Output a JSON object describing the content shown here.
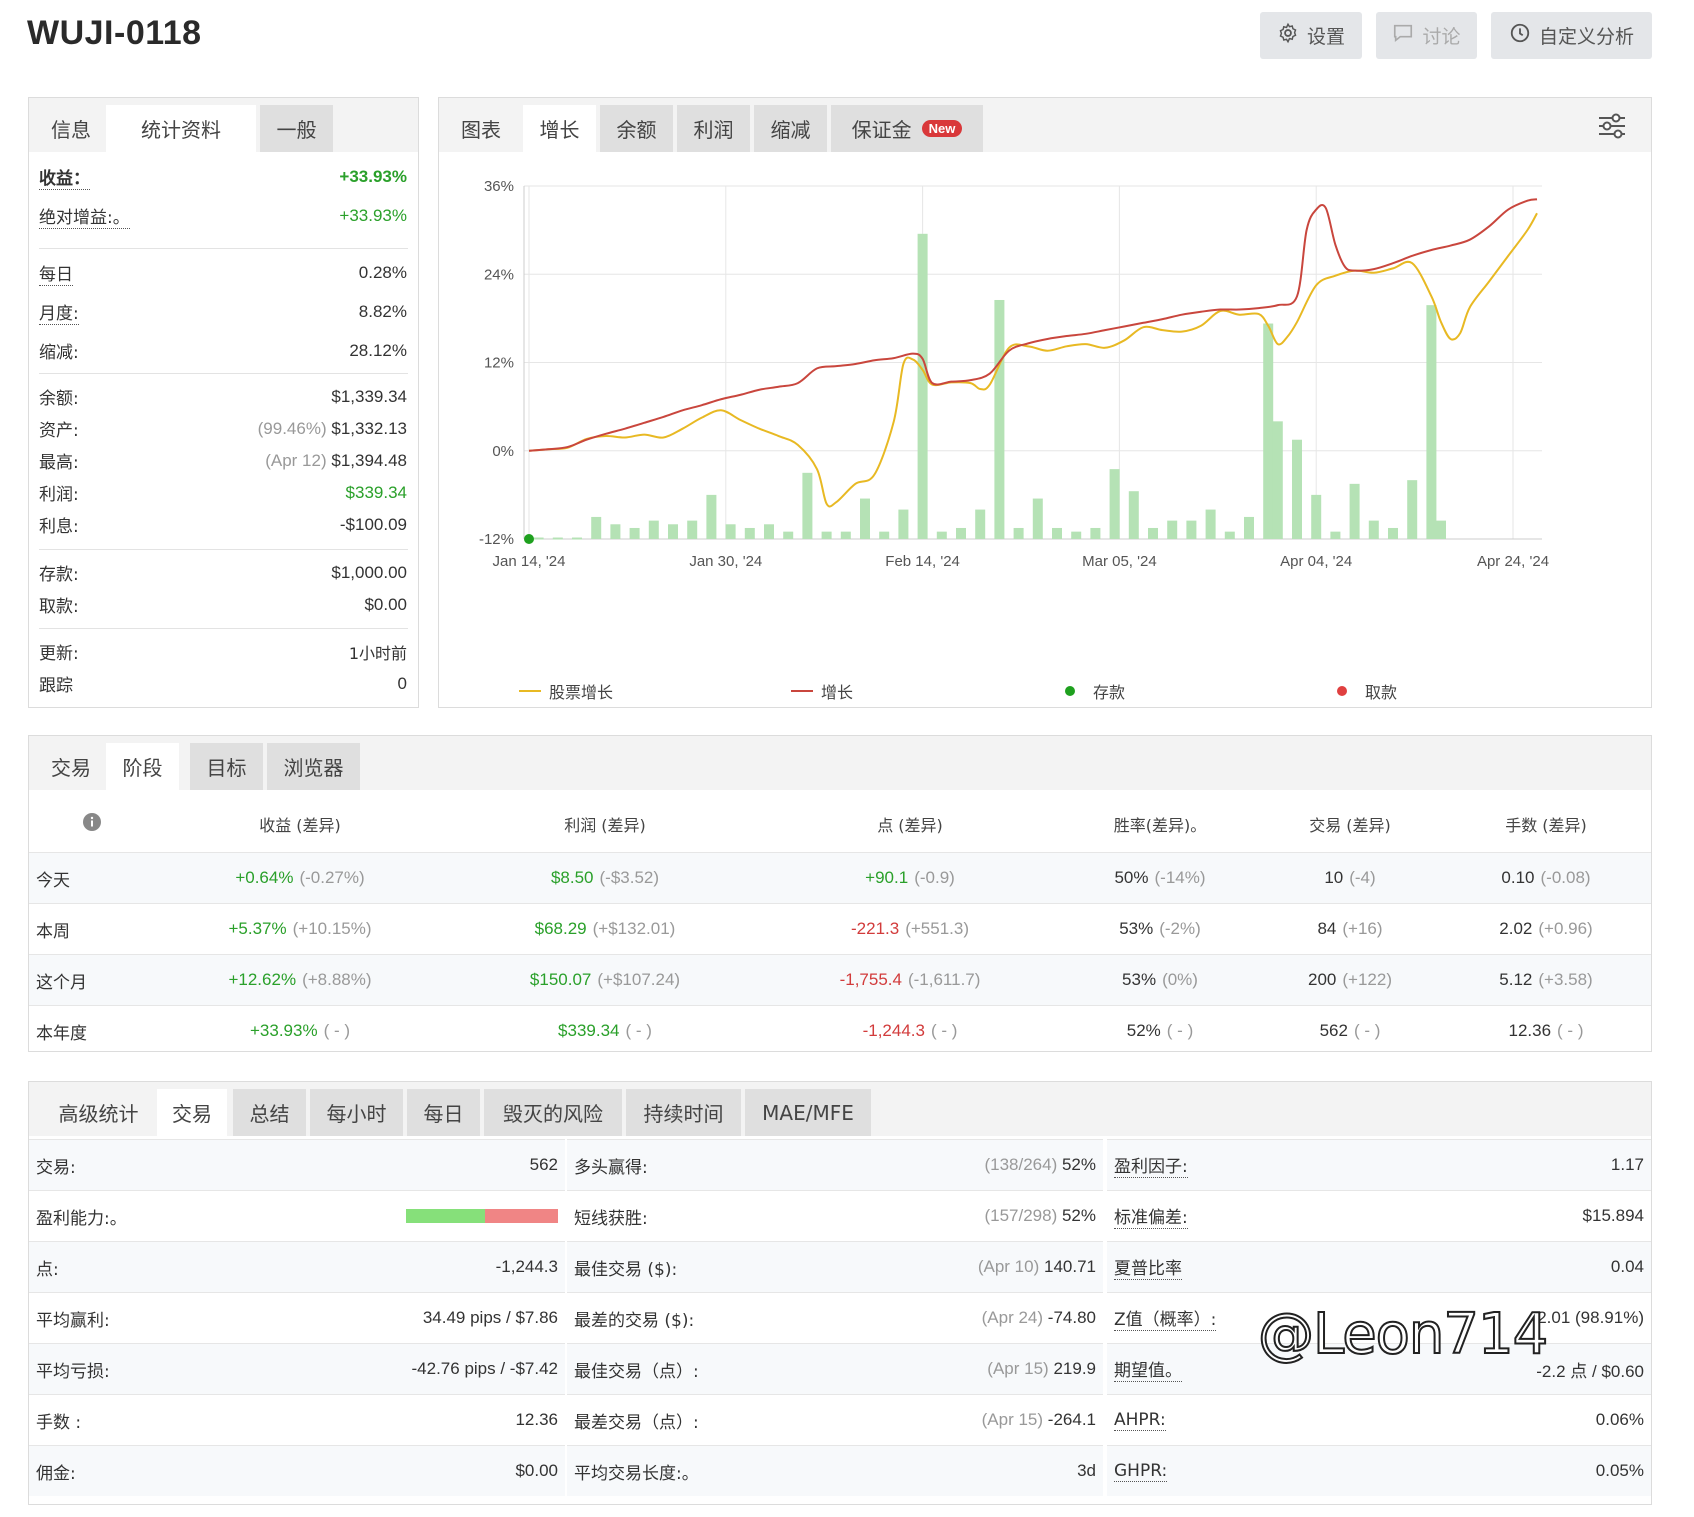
{
  "header": {
    "title": "WUJI-0118",
    "settings_label": "设置",
    "discuss_label": "讨论",
    "custom_label": "自定义分析"
  },
  "left_panel": {
    "tabs": [
      "信息",
      "统计资料",
      "一般"
    ],
    "gain_label": "收益：",
    "gain_value": "+33.93%",
    "abs_gain_label": "绝对增益:。",
    "abs_gain_value": "+33.93%",
    "daily_label": "每日",
    "daily_value": "0.28%",
    "monthly_label": "月度:",
    "monthly_value": "8.82%",
    "drawdown_label": "缩减:",
    "drawdown_value": "28.12%",
    "balance_label": "余额:",
    "balance_value": "$1,339.34",
    "equity_label": "资产:",
    "equity_pct": "(99.46%)",
    "equity_value": "$1,332.13",
    "highest_label": "最高:",
    "highest_date": "(Apr 12)",
    "highest_value": "$1,394.48",
    "profit_label": "利润:",
    "profit_value": "$339.34",
    "interest_label": "利息:",
    "interest_value": "-$100.09",
    "deposits_label": "存款:",
    "deposits_value": "$1,000.00",
    "withdrawals_label": "取款:",
    "withdrawals_value": "$0.00",
    "updated_label": "更新:",
    "updated_value": "1小时前",
    "tracking_label": "跟踪",
    "tracking_value": "0"
  },
  "chart_panel": {
    "tabs": [
      "图表",
      "增长",
      "余额",
      "利润",
      "缩减",
      "保证金"
    ],
    "new_badge": "New",
    "filter_icon": "sliders-icon"
  },
  "chart_data": {
    "type": "line",
    "y_ticks": [
      "36%",
      "24%",
      "12%",
      "0%",
      "-12%"
    ],
    "ylim": [
      -12,
      36
    ],
    "x_ticks": [
      "Jan 14, '24",
      "Jan 30, '24",
      "Feb 14, '24",
      "Mar 05, '24",
      "Apr 04, '24",
      "Apr 24, '24"
    ],
    "legend": [
      "股票增长",
      "增长",
      "存款",
      "取款"
    ],
    "colors": {
      "equity": "#e8b923",
      "growth": "#c9463d",
      "bars": "#b5e2b5",
      "deposit": "#1ea01e",
      "withdraw": "#e04040"
    },
    "growth": [
      [
        0,
        0
      ],
      [
        2,
        0.2
      ],
      [
        4,
        0.5
      ],
      [
        6,
        1.5
      ],
      [
        8,
        2.3
      ],
      [
        10,
        3.0
      ],
      [
        12,
        3.8
      ],
      [
        14,
        4.6
      ],
      [
        16,
        5.5
      ],
      [
        18,
        6.2
      ],
      [
        20,
        7.0
      ],
      [
        22,
        7.6
      ],
      [
        24,
        8.3
      ],
      [
        26,
        8.7
      ],
      [
        28,
        9.2
      ],
      [
        30,
        11.2
      ],
      [
        32,
        11.5
      ],
      [
        34,
        11.8
      ],
      [
        36,
        12.3
      ],
      [
        38,
        12.6
      ],
      [
        40,
        13.2
      ],
      [
        41,
        12.5
      ],
      [
        42,
        9.2
      ],
      [
        44,
        9.4
      ],
      [
        46,
        9.6
      ],
      [
        48,
        10.5
      ],
      [
        50,
        13.6
      ],
      [
        52,
        14.6
      ],
      [
        54,
        15.2
      ],
      [
        56,
        15.6
      ],
      [
        58,
        15.9
      ],
      [
        60,
        16.4
      ],
      [
        62,
        16.9
      ],
      [
        64,
        17.4
      ],
      [
        66,
        17.9
      ],
      [
        68,
        18.5
      ],
      [
        70,
        18.9
      ],
      [
        72,
        19.2
      ],
      [
        74,
        19.2
      ],
      [
        76,
        19.4
      ],
      [
        78,
        19.8
      ],
      [
        80,
        21.0
      ],
      [
        81,
        30.0
      ],
      [
        82,
        32.8
      ],
      [
        83,
        33.0
      ],
      [
        84,
        28.0
      ],
      [
        85,
        25.0
      ],
      [
        86,
        24.5
      ],
      [
        88,
        24.7
      ],
      [
        90,
        25.5
      ],
      [
        92,
        26.5
      ],
      [
        94,
        27.3
      ],
      [
        96,
        27.9
      ],
      [
        98,
        28.7
      ],
      [
        100,
        30.5
      ],
      [
        102,
        32.8
      ],
      [
        104,
        34.0
      ],
      [
        105,
        34.2
      ]
    ],
    "equity": [
      [
        0,
        0
      ],
      [
        2,
        0.2
      ],
      [
        4,
        0.4
      ],
      [
        6,
        1.6
      ],
      [
        8,
        2.0
      ],
      [
        10,
        1.8
      ],
      [
        12,
        2.2
      ],
      [
        14,
        1.8
      ],
      [
        16,
        3.0
      ],
      [
        18,
        4.5
      ],
      [
        20,
        5.5
      ],
      [
        22,
        4.2
      ],
      [
        24,
        3.0
      ],
      [
        26,
        2.0
      ],
      [
        28,
        0.8
      ],
      [
        30,
        -2.5
      ],
      [
        31,
        -7.2
      ],
      [
        32,
        -7.0
      ],
      [
        34,
        -4.5
      ],
      [
        36,
        -3.2
      ],
      [
        38,
        4.0
      ],
      [
        39,
        11.8
      ],
      [
        40,
        12.4
      ],
      [
        41,
        11.0
      ],
      [
        42,
        9.0
      ],
      [
        44,
        9.3
      ],
      [
        46,
        9.2
      ],
      [
        47,
        8.4
      ],
      [
        48,
        9.0
      ],
      [
        50,
        14.0
      ],
      [
        52,
        14.2
      ],
      [
        54,
        13.6
      ],
      [
        56,
        14.2
      ],
      [
        58,
        14.5
      ],
      [
        60,
        14.0
      ],
      [
        62,
        15.0
      ],
      [
        64,
        16.8
      ],
      [
        66,
        16.4
      ],
      [
        68,
        16.2
      ],
      [
        70,
        17.0
      ],
      [
        72,
        19.0
      ],
      [
        74,
        18.5
      ],
      [
        76,
        18.6
      ],
      [
        77,
        17.0
      ],
      [
        78,
        14.5
      ],
      [
        79,
        15.5
      ],
      [
        80,
        17.5
      ],
      [
        82,
        22.5
      ],
      [
        84,
        23.8
      ],
      [
        86,
        24.5
      ],
      [
        88,
        24.2
      ],
      [
        90,
        24.8
      ],
      [
        92,
        25.5
      ],
      [
        94,
        21.0
      ],
      [
        95,
        17.5
      ],
      [
        96,
        15.2
      ],
      [
        97,
        16.0
      ],
      [
        98,
        19.5
      ],
      [
        100,
        23.0
      ],
      [
        102,
        26.5
      ],
      [
        104,
        30.0
      ],
      [
        105,
        32.3
      ]
    ],
    "bars": [
      [
        1,
        -11.8
      ],
      [
        3,
        -11.8
      ],
      [
        5,
        -11.8
      ],
      [
        7,
        -9
      ],
      [
        9,
        -10
      ],
      [
        11,
        -10.5
      ],
      [
        13,
        -9.5
      ],
      [
        15,
        -10
      ],
      [
        17,
        -9.5
      ],
      [
        19,
        -6
      ],
      [
        21,
        -10
      ],
      [
        23,
        -10.5
      ],
      [
        25,
        -10
      ],
      [
        27,
        -11
      ],
      [
        29,
        -3
      ],
      [
        31,
        -11
      ],
      [
        33,
        -11
      ],
      [
        35,
        -6.5
      ],
      [
        37,
        -11
      ],
      [
        39,
        -8
      ],
      [
        41,
        29.5
      ],
      [
        43,
        -11
      ],
      [
        45,
        -10.5
      ],
      [
        47,
        -8
      ],
      [
        49,
        20.5
      ],
      [
        51,
        -10.5
      ],
      [
        53,
        -6.5
      ],
      [
        55,
        -10.5
      ],
      [
        57,
        -11
      ],
      [
        59,
        -10.5
      ],
      [
        61,
        -2.5
      ],
      [
        63,
        -5.5
      ],
      [
        65,
        -10.5
      ],
      [
        67,
        -9.5
      ],
      [
        69,
        -9.5
      ],
      [
        71,
        -8
      ],
      [
        73,
        -11
      ],
      [
        75,
        -9
      ],
      [
        77,
        17.3
      ],
      [
        78,
        4
      ],
      [
        80,
        1.5
      ],
      [
        82,
        -6
      ],
      [
        84,
        -11
      ],
      [
        86,
        -4.5
      ],
      [
        88,
        -9.5
      ],
      [
        90,
        -10.5
      ],
      [
        92,
        -4
      ],
      [
        94,
        19.8
      ],
      [
        95,
        -9.5
      ]
    ],
    "deposit_point": [
      0,
      -12
    ]
  },
  "period_panel": {
    "tabs": [
      "交易",
      "阶段",
      "目标",
      "浏览器"
    ],
    "info_icon": "info-icon",
    "headers": [
      "收益 (差异)",
      "利润 (差异)",
      "点 (差异)",
      "胜率(差异)。",
      "交易 (差异)",
      "手数 (差异)"
    ],
    "rows": [
      {
        "label": "今天",
        "gain": "+0.64%",
        "gain_d": "(-0.27%)",
        "profit": "$8.50",
        "profit_d": "(-$3.52)",
        "pips": "+90.1",
        "pips_d": "(-0.9)",
        "win": "50%",
        "win_d": "(-14%)",
        "trades": "10",
        "trades_d": "(-4)",
        "lots": "0.10",
        "lots_d": "(-0.08)"
      },
      {
        "label": "本周",
        "gain": "+5.37%",
        "gain_d": "(+10.15%)",
        "profit": "$68.29",
        "profit_d": "(+$132.01)",
        "pips": "-221.3",
        "pips_d": "(+551.3)",
        "win": "53%",
        "win_d": "(-2%)",
        "trades": "84",
        "trades_d": "(+16)",
        "lots": "2.02",
        "lots_d": "(+0.96)"
      },
      {
        "label": "这个月",
        "gain": "+12.62%",
        "gain_d": "(+8.88%)",
        "profit": "$150.07",
        "profit_d": "(+$107.24)",
        "pips": "-1,755.4",
        "pips_d": "(-1,611.7)",
        "win": "53%",
        "win_d": "(0%)",
        "trades": "200",
        "trades_d": "(+122)",
        "lots": "5.12",
        "lots_d": "(+3.58)"
      },
      {
        "label": "本年度",
        "gain": "+33.93%",
        "gain_d": "( - )",
        "profit": "$339.34",
        "profit_d": "( - )",
        "pips": "-1,244.3",
        "pips_d": "( - )",
        "win": "52%",
        "win_d": "( - )",
        "trades": "562",
        "trades_d": "( - )",
        "lots": "12.36",
        "lots_d": "( - )"
      }
    ]
  },
  "adv_panel": {
    "tabs": [
      "高级统计",
      "交易",
      "总结",
      "每小时",
      "每日",
      "毁灭的风险",
      "持续时间",
      "MAE/MFE"
    ],
    "col1": [
      {
        "label": "交易:",
        "value": "562"
      },
      {
        "label": "盈利能力:。",
        "value": ""
      },
      {
        "label": "点:",
        "value": "-1,244.3"
      },
      {
        "label": "平均赢利:",
        "value": "34.49 pips / $7.86"
      },
      {
        "label": "平均亏损:",
        "value": "-42.76 pips / -$7.42"
      },
      {
        "label": "手数 :",
        "value": "12.36"
      },
      {
        "label": "佣金:",
        "value": "$0.00"
      }
    ],
    "profitability_win_pct": 52,
    "col2": [
      {
        "label": "多头赢得:",
        "note": "(138/264)",
        "value": "52%"
      },
      {
        "label": "短线获胜:",
        "note": "(157/298)",
        "value": "52%"
      },
      {
        "label": "最佳交易 ($):",
        "note": "(Apr 10)",
        "value": "140.71"
      },
      {
        "label": "最差的交易 ($):",
        "note": "(Apr 24)",
        "value": "-74.80"
      },
      {
        "label": "最佳交易（点）:",
        "note": "(Apr 15)",
        "value": "219.9"
      },
      {
        "label": "最差交易（点）:",
        "note": "(Apr 15)",
        "value": "-264.1"
      },
      {
        "label": "平均交易长度:。",
        "note": "",
        "value": "3d"
      }
    ],
    "col3": [
      {
        "label": "盈利因子:",
        "value": "1.17"
      },
      {
        "label": "标准偏差:",
        "value": "$15.894"
      },
      {
        "label": "夏普比率",
        "value": "0.04"
      },
      {
        "label": "Z值（概率）:",
        "value": "-2.01 (98.91%)"
      },
      {
        "label": "期望值。",
        "value": "-2.2 点 / $0.60"
      },
      {
        "label": "AHPR:",
        "value": "0.06%"
      },
      {
        "label": "GHPR:",
        "value": "0.05%"
      }
    ]
  },
  "watermark": "@Leon714"
}
